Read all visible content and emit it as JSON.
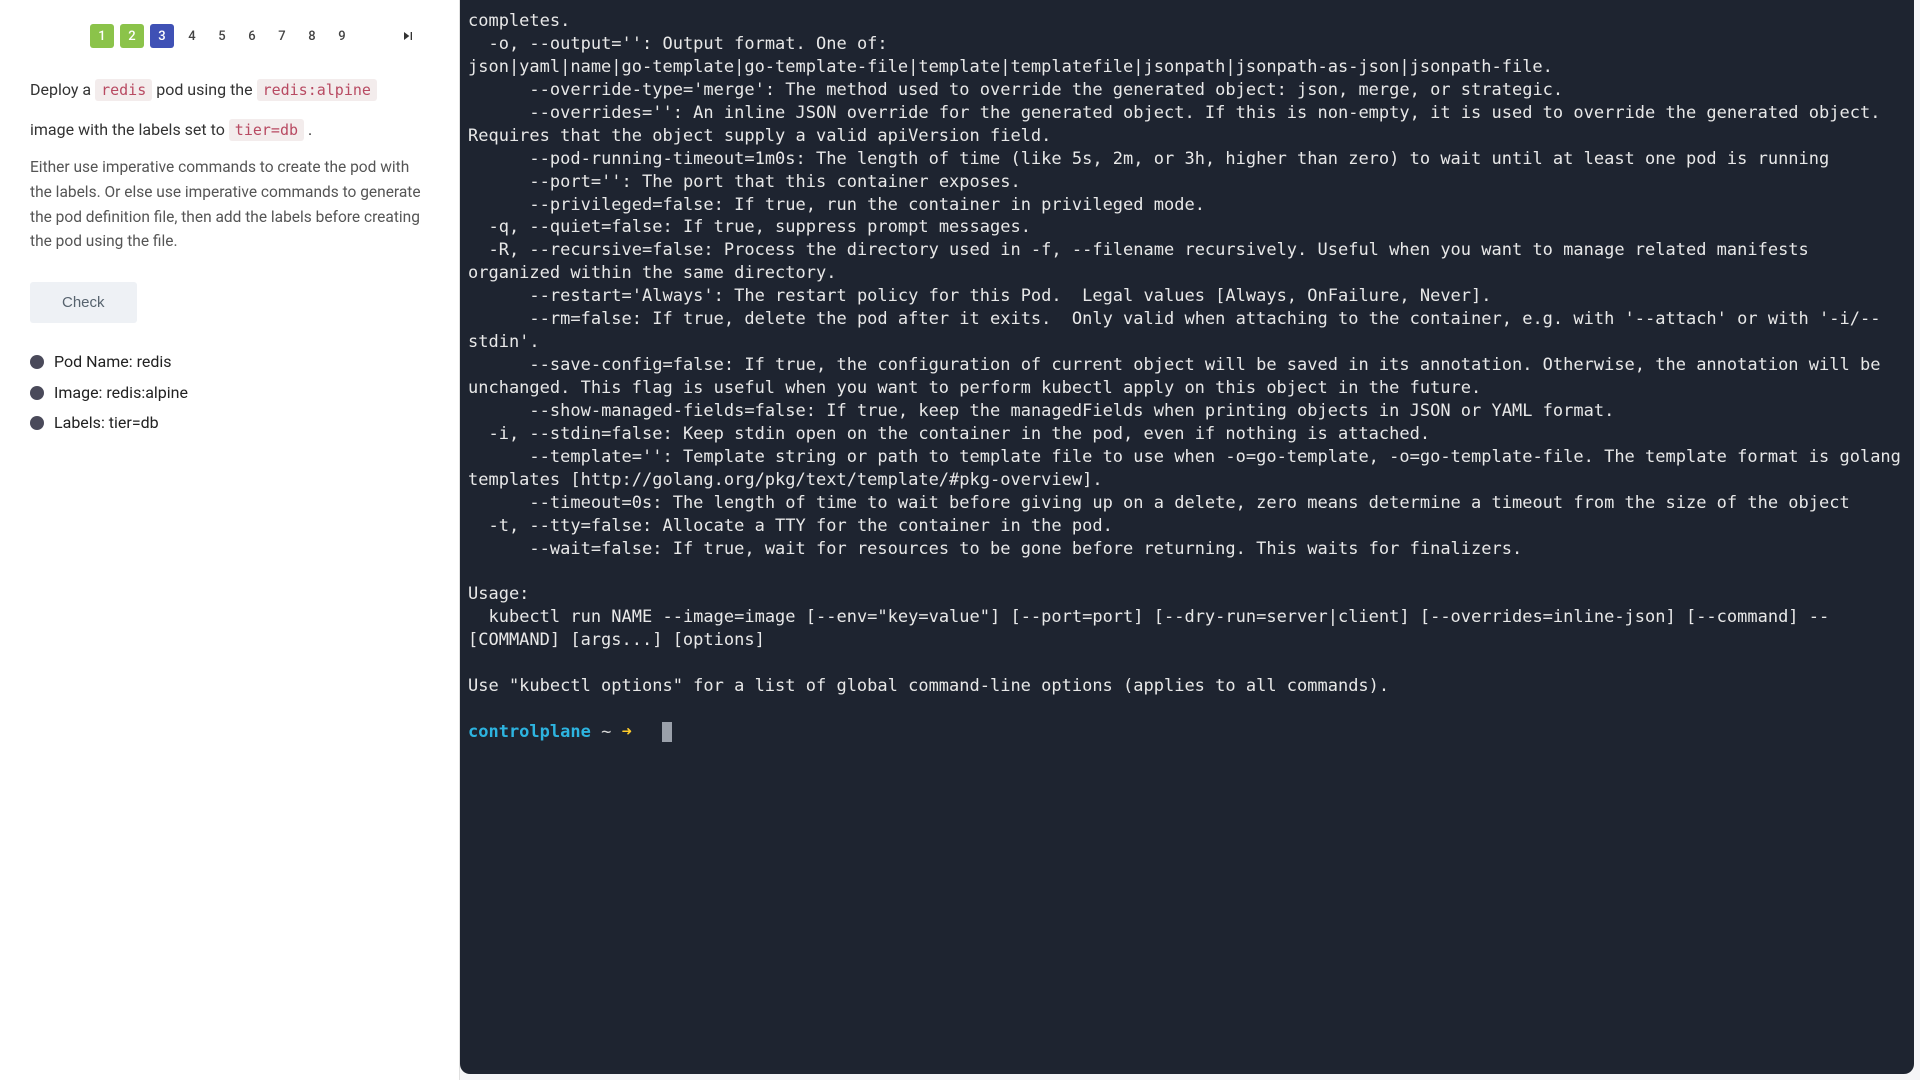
{
  "pager": {
    "items": [
      {
        "n": "1",
        "state": "done"
      },
      {
        "n": "2",
        "state": "done"
      },
      {
        "n": "3",
        "state": "current"
      },
      {
        "n": "4",
        "state": ""
      },
      {
        "n": "5",
        "state": ""
      },
      {
        "n": "6",
        "state": ""
      },
      {
        "n": "7",
        "state": ""
      },
      {
        "n": "8",
        "state": ""
      },
      {
        "n": "9",
        "state": ""
      }
    ]
  },
  "instr": {
    "t1": "Deploy a ",
    "c1": "redis",
    "t2": " pod using the ",
    "c2": "redis:alpine",
    "t3": "image with the labels set to ",
    "c3": "tier=db",
    "t4": " ."
  },
  "subtext": "Either use imperative commands to create the pod with the labels. Or else use imperative commands to generate the pod definition file, then add the labels before creating the pod using the file.",
  "check_label": "Check",
  "checks": {
    "a": "Pod Name: redis",
    "b": "Image: redis:alpine",
    "c": "Labels: tier=db"
  },
  "term": {
    "body": "completes.\n  -o, --output='': Output format. One of:\njson|yaml|name|go-template|go-template-file|template|templatefile|jsonpath|jsonpath-as-json|jsonpath-file.\n      --override-type='merge': The method used to override the generated object: json, merge, or strategic.\n      --overrides='': An inline JSON override for the generated object. If this is non-empty, it is used to override the generated object. Requires that the object supply a valid apiVersion field.\n      --pod-running-timeout=1m0s: The length of time (like 5s, 2m, or 3h, higher than zero) to wait until at least one pod is running\n      --port='': The port that this container exposes.\n      --privileged=false: If true, run the container in privileged mode.\n  -q, --quiet=false: If true, suppress prompt messages.\n  -R, --recursive=false: Process the directory used in -f, --filename recursively. Useful when you want to manage related manifests organized within the same directory.\n      --restart='Always': The restart policy for this Pod.  Legal values [Always, OnFailure, Never].\n      --rm=false: If true, delete the pod after it exits.  Only valid when attaching to the container, e.g. with '--attach' or with '-i/--stdin'.\n      --save-config=false: If true, the configuration of current object will be saved in its annotation. Otherwise, the annotation will be unchanged. This flag is useful when you want to perform kubectl apply on this object in the future.\n      --show-managed-fields=false: If true, keep the managedFields when printing objects in JSON or YAML format.\n  -i, --stdin=false: Keep stdin open on the container in the pod, even if nothing is attached.\n      --template='': Template string or path to template file to use when -o=go-template, -o=go-template-file. The template format is golang templates [http://golang.org/pkg/text/template/#pkg-overview].\n      --timeout=0s: The length of time to wait before giving up on a delete, zero means determine a timeout from the size of the object\n  -t, --tty=false: Allocate a TTY for the container in the pod.\n      --wait=false: If true, wait for resources to be gone before returning. This waits for finalizers.\n\nUsage:\n  kubectl run NAME --image=image [--env=\"key=value\"] [--port=port] [--dry-run=server|client] [--overrides=inline-json] [--command] -- [COMMAND] [args...] [options]\n\nUse \"kubectl options\" for a list of global command-line options (applies to all commands).\n",
    "prompt_host": "controlplane",
    "prompt_tilde": "~",
    "prompt_arrow": "➜"
  }
}
